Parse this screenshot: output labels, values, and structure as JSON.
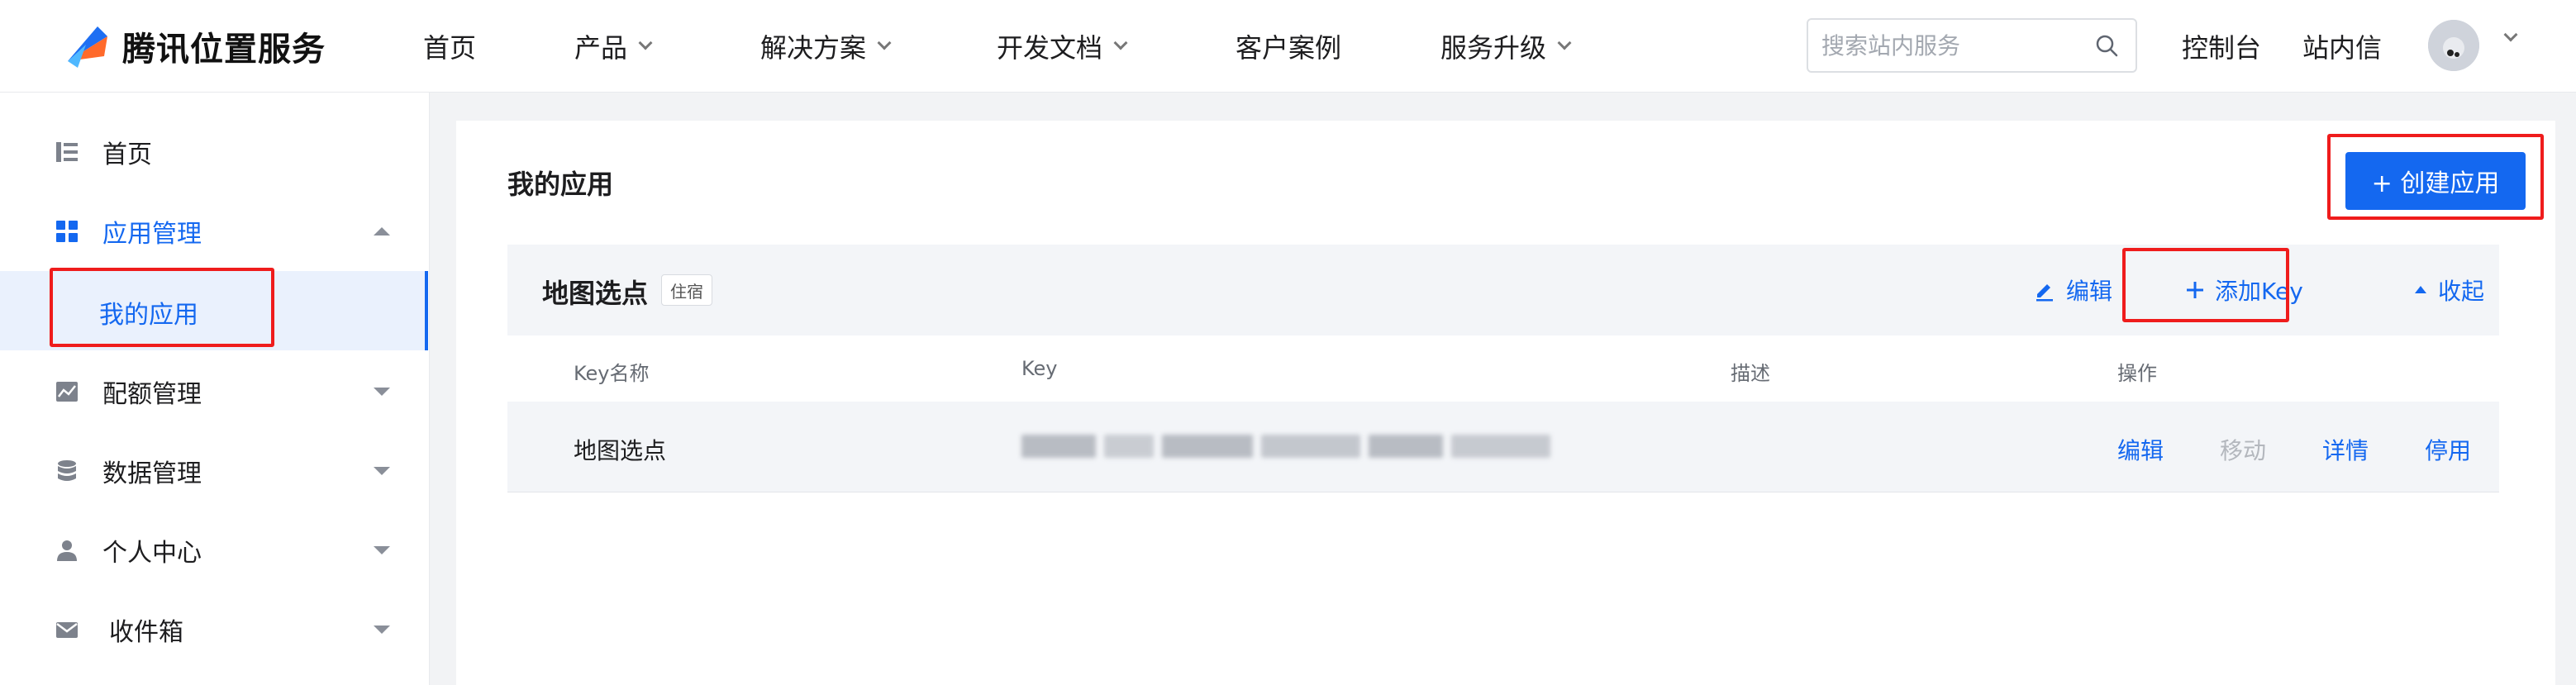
{
  "header": {
    "logo_text": "腾讯位置服务",
    "nav": [
      {
        "label": "首页",
        "has_dropdown": false
      },
      {
        "label": "产品",
        "has_dropdown": true
      },
      {
        "label": "解决方案",
        "has_dropdown": true
      },
      {
        "label": "开发文档",
        "has_dropdown": true
      },
      {
        "label": "客户案例",
        "has_dropdown": false
      },
      {
        "label": "服务升级",
        "has_dropdown": true
      }
    ],
    "search_placeholder": "搜索站内服务",
    "console_label": "控制台",
    "inbox_label": "站内信"
  },
  "sidebar": {
    "items": [
      {
        "label": "首页",
        "icon": "list-icon",
        "expanded": null
      },
      {
        "label": "应用管理",
        "icon": "grid-icon",
        "expanded": true,
        "active": true
      },
      {
        "label": "配额管理",
        "icon": "chart-icon",
        "expanded": false
      },
      {
        "label": "数据管理",
        "icon": "database-icon",
        "expanded": false
      },
      {
        "label": "个人中心",
        "icon": "user-icon",
        "expanded": false
      },
      {
        "label": "收件箱",
        "icon": "mail-icon",
        "expanded": false
      }
    ],
    "sub_item": "我的应用"
  },
  "main": {
    "title": "我的应用",
    "create_button": "+ 创建应用",
    "app": {
      "name": "地图选点",
      "tag": "住宿",
      "edit_label": "编辑",
      "add_key_label": "添加Key",
      "collapse_label": "收起",
      "columns": [
        "Key名称",
        "Key",
        "描述",
        "操作"
      ],
      "rows": [
        {
          "key_name": "地图选点",
          "key": "",
          "description": "",
          "ops": [
            "编辑",
            "移动",
            "详情",
            "停用"
          ],
          "disabled_ops": [
            "移动"
          ]
        }
      ]
    }
  },
  "colors": {
    "primary": "#1468f0",
    "highlight_box": "#ef1c1c",
    "disabled": "#b3b7bd"
  }
}
